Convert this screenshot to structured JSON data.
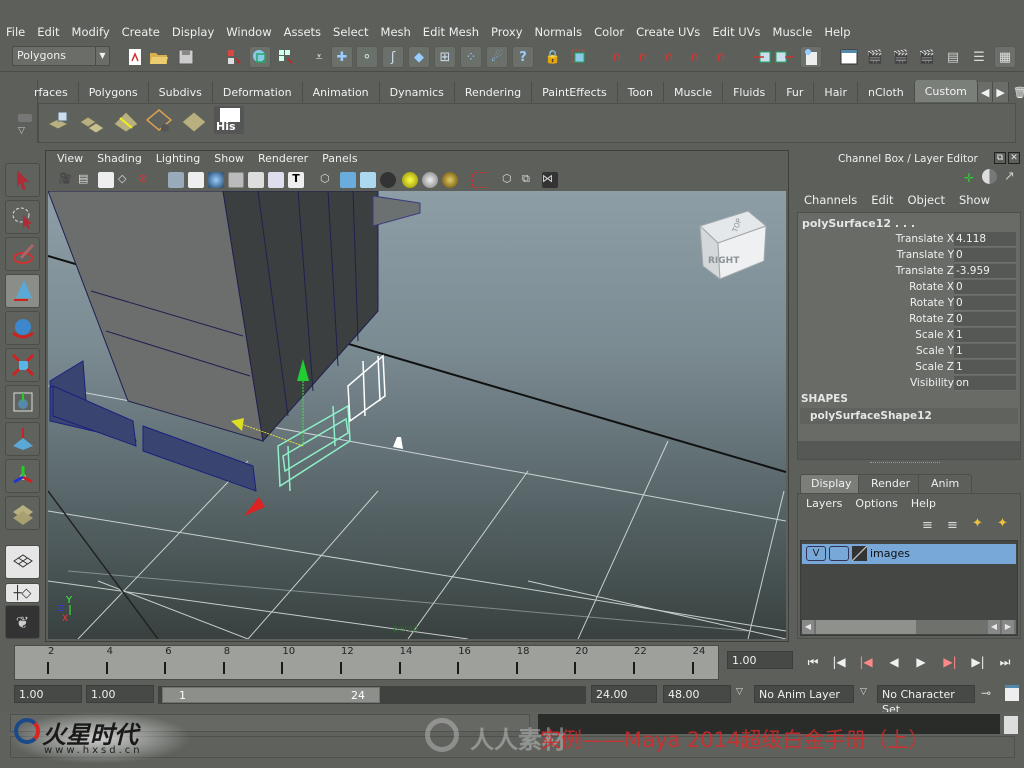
{
  "menubar": [
    "File",
    "Edit",
    "Modify",
    "Create",
    "Display",
    "Window",
    "Assets",
    "Select",
    "Mesh",
    "Edit Mesh",
    "Proxy",
    "Normals",
    "Color",
    "Create UVs",
    "Edit UVs",
    "Muscle",
    "Help"
  ],
  "status_line": {
    "mode_selector": "Polygons",
    "icons": [
      "new-scene-icon",
      "open-scene-icon",
      "save-scene-icon",
      "select-by-hierarchy-icon",
      "select-by-object-icon",
      "select-by-component-icon",
      "mask-icon",
      "handles-icon",
      "joints-icon",
      "curves-icon",
      "surfaces-icon",
      "deformations-icon",
      "dynamics-icon",
      "rendering-icon",
      "misc-icon",
      "lock-icon",
      "highlight-selection-icon",
      "snap-grid-icon",
      "snap-curve-icon",
      "snap-point-icon",
      "snap-view-plane-icon",
      "snap-live-icon",
      "input-ops-icon",
      "output-ops-icon",
      "construction-history-icon",
      "render-view-icon",
      "render-current-icon",
      "ipr-render-icon",
      "render-settings-icon",
      "hypershade-icon",
      "attribute-editor-icon",
      "channel-box-icon"
    ]
  },
  "shelf": {
    "tabs": [
      "rfaces",
      "Polygons",
      "Subdivs",
      "Deformation",
      "Animation",
      "Dynamics",
      "Rendering",
      "PaintEffects",
      "Toon",
      "Muscle",
      "Fluids",
      "Fur",
      "Hair",
      "nCloth",
      "Custom"
    ],
    "active_tab": "Custom",
    "items": [
      {
        "icon": "combine-poly-icon"
      },
      {
        "icon": "separate-poly-icon"
      },
      {
        "icon": "insert-edge-loop-icon"
      },
      {
        "icon": "delete-edges-icon"
      },
      {
        "icon": "merge-vertices-icon"
      },
      {
        "icon": "history-icon",
        "label": "His"
      }
    ]
  },
  "toolbox": [
    "select-tool-icon",
    "lasso-tool-icon",
    "paint-select-tool-icon",
    "move-tool-icon",
    "rotate-tool-icon",
    "scale-tool-icon",
    "universal-manipulator-icon",
    "soft-mod-icon",
    "show-manipulator-icon",
    "last-tool-icon",
    "single-perspective-layout-icon",
    "four-view-layout-icon",
    "mudbox-icon"
  ],
  "viewport": {
    "menu": [
      "View",
      "Shading",
      "Lighting",
      "Show",
      "Renderer",
      "Panels"
    ],
    "view_cube": {
      "front_label": "RIGHT",
      "top_label": "TOP"
    },
    "camera_label": "persp",
    "axis": {
      "x": "X",
      "y": "Y",
      "z": "Z"
    }
  },
  "channel_box": {
    "title": "Channel Box / Layer Editor",
    "menu": [
      "Channels",
      "Edit",
      "Object",
      "Show"
    ],
    "object_name": "polySurface12 . . .",
    "channels": [
      {
        "label": "Translate X",
        "value": "4.118"
      },
      {
        "label": "Translate Y",
        "value": "0"
      },
      {
        "label": "Translate Z",
        "value": "-3.959"
      },
      {
        "label": "Rotate X",
        "value": "0"
      },
      {
        "label": "Rotate Y",
        "value": "0"
      },
      {
        "label": "Rotate Z",
        "value": "0"
      },
      {
        "label": "Scale X",
        "value": "1"
      },
      {
        "label": "Scale Y",
        "value": "1"
      },
      {
        "label": "Scale Z",
        "value": "1"
      },
      {
        "label": "Visibility",
        "value": "on"
      }
    ],
    "shapes_header": "SHAPES",
    "shape_name": "polySurfaceShape12"
  },
  "layer_editor": {
    "tabs": [
      "Display",
      "Render",
      "Anim"
    ],
    "active_tab": "Display",
    "menu": [
      "Layers",
      "Options",
      "Help"
    ],
    "layers": [
      {
        "visible": "V",
        "name": "images"
      }
    ]
  },
  "time_slider": {
    "ticks": [
      "2",
      "4",
      "6",
      "8",
      "10",
      "12",
      "14",
      "16",
      "18",
      "20",
      "22",
      "24"
    ],
    "current_time": "1.00"
  },
  "range_slider": {
    "start_time": "1.00",
    "playback_start": "1.00",
    "range_start_label": "1",
    "range_end_label": "24",
    "playback_end": "24.00",
    "end_time": "48.00",
    "anim_layer": "No Anim Layer",
    "character_set": "No Character Set"
  },
  "watermark": {
    "logo_text": "火星时代",
    "logo_url_text": "www.hxsd.cn",
    "title_text": "实例——Maya 2014超级白金手册（上）",
    "site_text": "人人素材"
  }
}
